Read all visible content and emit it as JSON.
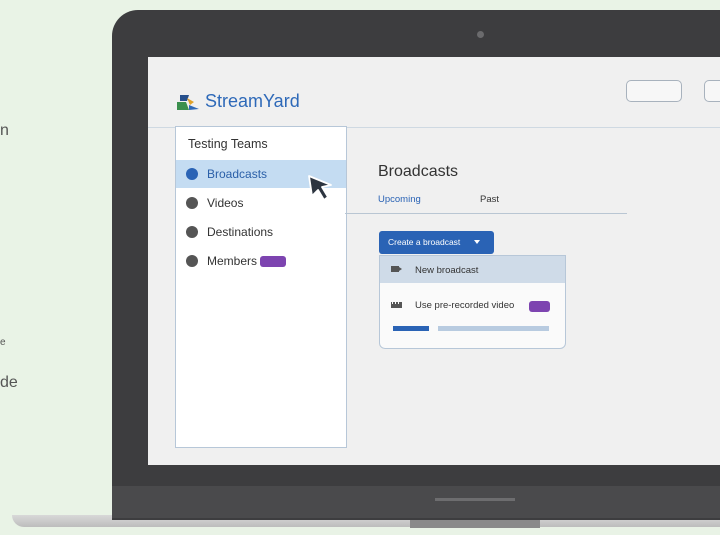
{
  "background_fragments": {
    "top": "n",
    "middle": "e",
    "bottom": "de"
  },
  "logo": {
    "text": "StreamYard"
  },
  "sidebar": {
    "title": "Testing Teams",
    "items": [
      {
        "label": "Broadcasts",
        "active": true
      },
      {
        "label": "Videos"
      },
      {
        "label": "Destinations"
      },
      {
        "label": "Members",
        "badge": true
      }
    ]
  },
  "main": {
    "title": "Broadcasts",
    "tabs": [
      {
        "label": "Upcoming",
        "active": true
      },
      {
        "label": "Past"
      }
    ],
    "create_button": {
      "label": "Create a broadcast"
    },
    "dropdown": {
      "items": [
        {
          "label": "New broadcast",
          "icon": "video-camera-icon"
        },
        {
          "label": "Use pre-recorded video",
          "icon": "film-icon",
          "badge": true
        }
      ],
      "progress": 0.25
    }
  },
  "colors": {
    "accent": "#2a63b5",
    "badge": "#7d44b0",
    "active_bg": "#c4dcf2"
  }
}
